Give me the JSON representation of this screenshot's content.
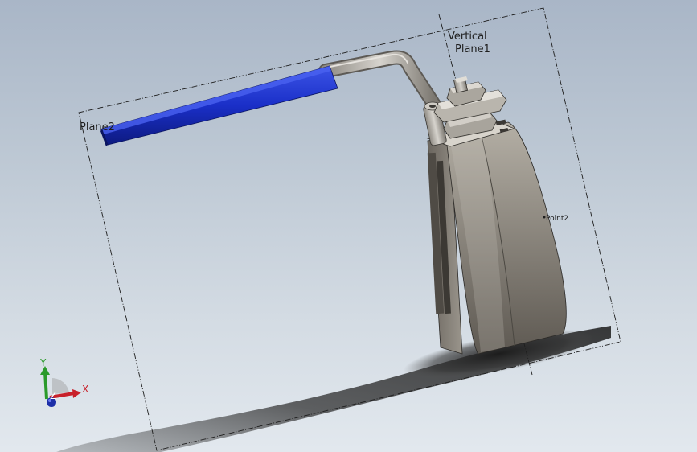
{
  "viewport": {
    "plane_labels": {
      "vertical_line1": "Vertical",
      "vertical_line2": "Plane1",
      "left_plane": "Plane2",
      "point": "Point2"
    },
    "triad": {
      "x_label": "X",
      "y_label": "Y",
      "z_label": "Z",
      "x_color": "#c8202a",
      "y_color": "#2a9a2a",
      "z_color": "#1d2fa8"
    },
    "colors": {
      "handle_grip": "#1a2fc8",
      "valve_body": "#7d786f",
      "background_top": "#a9b6c7",
      "background_bottom": "#e2e8ee"
    }
  }
}
